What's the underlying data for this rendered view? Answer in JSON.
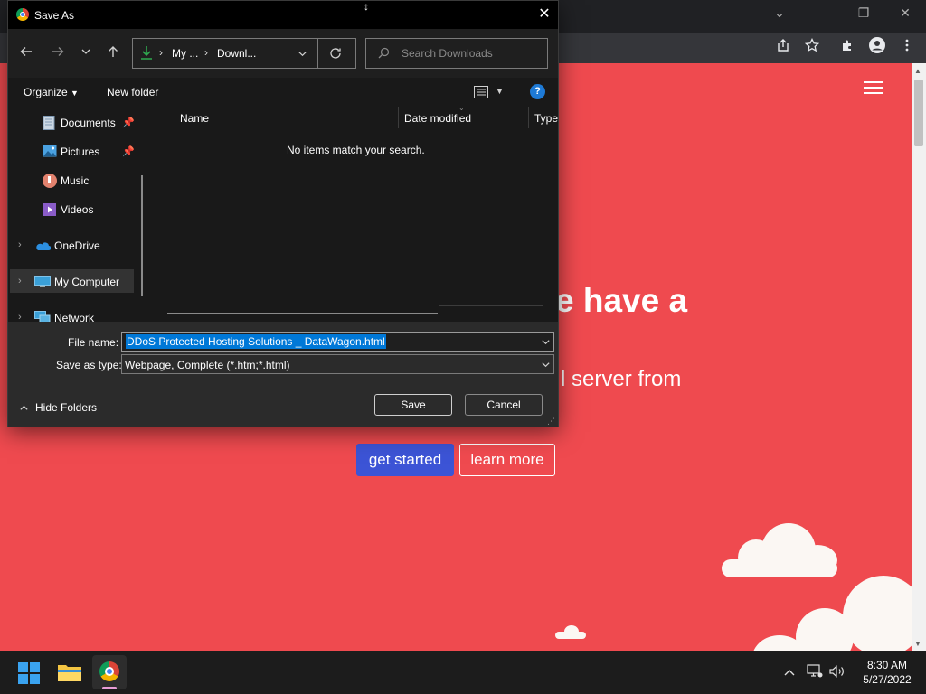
{
  "browser": {
    "window_controls": [
      "⌄",
      "—",
      "❐",
      "✕"
    ],
    "toolbar_icons": [
      "share-icon",
      "star-icon",
      "extensions-icon",
      "profile-icon",
      "menu-icon"
    ]
  },
  "page": {
    "headline_fragment": "e have a",
    "subline_fragment": "l server from",
    "primary_button": "get started",
    "secondary_button": "learn more",
    "colors": {
      "background": "#ef4a4f",
      "primary_button": "#3c54d6"
    }
  },
  "dialog": {
    "title": "Save As",
    "breadcrumb": {
      "part1": "My ...",
      "part2": "Downl..."
    },
    "search_placeholder": "Search Downloads",
    "toolbar": {
      "organize": "Organize",
      "new_folder": "New folder"
    },
    "nav": [
      {
        "label": "Documents",
        "pinned": true,
        "icon": "documents-icon"
      },
      {
        "label": "Pictures",
        "pinned": true,
        "icon": "pictures-icon"
      },
      {
        "label": "Music",
        "pinned": false,
        "icon": "music-icon"
      },
      {
        "label": "Videos",
        "pinned": false,
        "icon": "videos-icon"
      },
      {
        "label": "OneDrive",
        "pinned": false,
        "icon": "onedrive-icon"
      },
      {
        "label": "My Computer",
        "pinned": false,
        "icon": "computer-icon"
      },
      {
        "label": "Network",
        "pinned": false,
        "icon": "network-icon"
      }
    ],
    "columns": {
      "name": "Name",
      "date_modified": "Date modified",
      "type": "Type"
    },
    "empty_message": "No items match your search.",
    "file_name_label": "File name:",
    "file_name_value": "DDoS Protected Hosting Solutions _ DataWagon.html",
    "save_as_type_label": "Save as type:",
    "save_as_type_value": "Webpage, Complete (*.htm;*.html)",
    "hide_folders": "Hide Folders",
    "save_button": "Save",
    "cancel_button": "Cancel"
  },
  "taskbar": {
    "time": "8:30 AM",
    "date": "5/27/2022"
  }
}
